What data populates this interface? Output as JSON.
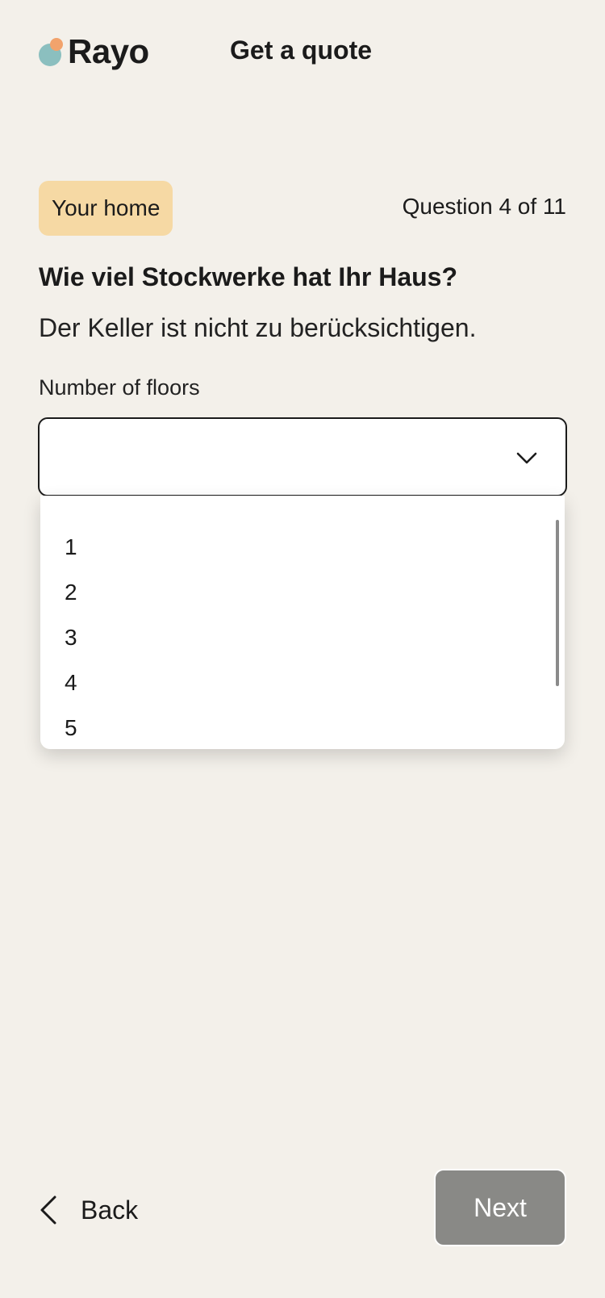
{
  "header": {
    "logo_text": "Rayo",
    "title": "Get a quote"
  },
  "progress": {
    "section_label": "Your home",
    "counter_text": "Question 4 of 11",
    "current": 4,
    "total": 11
  },
  "question": {
    "title": "Wie viel Stockwerke hat Ihr Haus?",
    "hint": "Der Keller ist nicht zu berücksichtigen."
  },
  "field": {
    "label": "Number of floors",
    "value": "",
    "options": [
      "1",
      "2",
      "3",
      "4",
      "5"
    ]
  },
  "footer": {
    "back_label": "Back",
    "next_label": "Next"
  },
  "colors": {
    "background": "#f3f0ea",
    "badge": "#f6d9a4",
    "logo_teal": "#8bbfbf",
    "logo_orange": "#f2a36c",
    "next_button_disabled": "#898986"
  }
}
